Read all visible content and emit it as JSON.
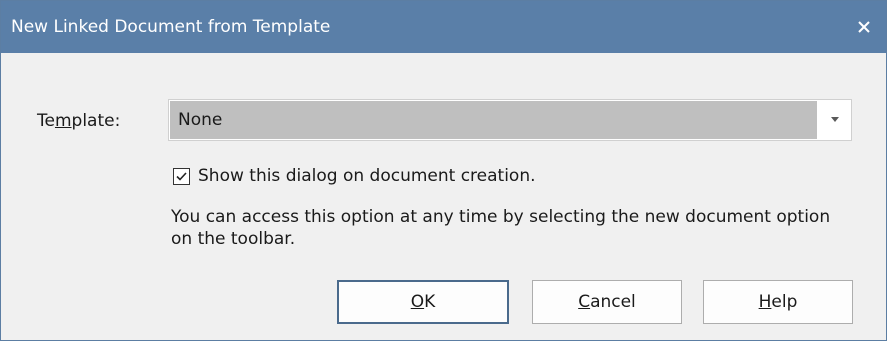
{
  "dialog": {
    "title": "New Linked Document from Template",
    "close_icon": "close-icon"
  },
  "template": {
    "label_pre": "Te",
    "label_accel": "m",
    "label_post": "plate:",
    "selected_value": "None",
    "dropdown_icon": "chevron-down-icon"
  },
  "show_dialog": {
    "checked": true,
    "label": "Show this dialog on document creation."
  },
  "info_text": "You can access this option at any time by selecting the new document option on the toolbar.",
  "buttons": {
    "ok_accel": "O",
    "ok_rest": "K",
    "cancel_accel": "C",
    "cancel_rest": "ancel",
    "help_accel": "H",
    "help_rest": "elp"
  },
  "colors": {
    "titlebar": "#5a7fa8",
    "dialog_bg": "#f0f0f0",
    "select_bg": "#bfbfbf"
  }
}
